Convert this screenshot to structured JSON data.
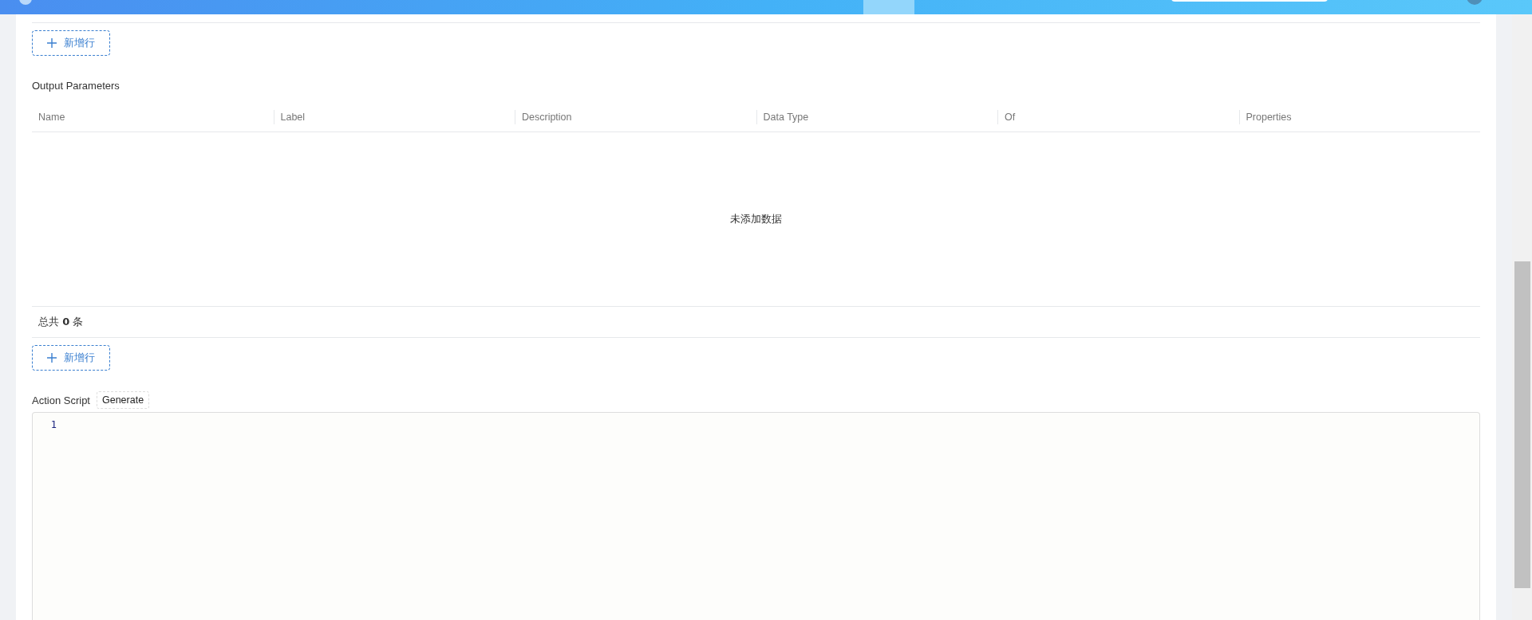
{
  "top_add_button": {
    "label": "新增行"
  },
  "output_parameters": {
    "title": "Output Parameters",
    "columns": [
      "Name",
      "Label",
      "Description",
      "Data Type",
      "Of",
      "Properties"
    ],
    "empty_text": "未添加数据",
    "total": "总共 **0** 条",
    "add_button": {
      "label": "新增行"
    }
  },
  "action_script": {
    "label": "Action Script",
    "generate_button": "Generate",
    "line_numbers": [
      "1"
    ]
  }
}
